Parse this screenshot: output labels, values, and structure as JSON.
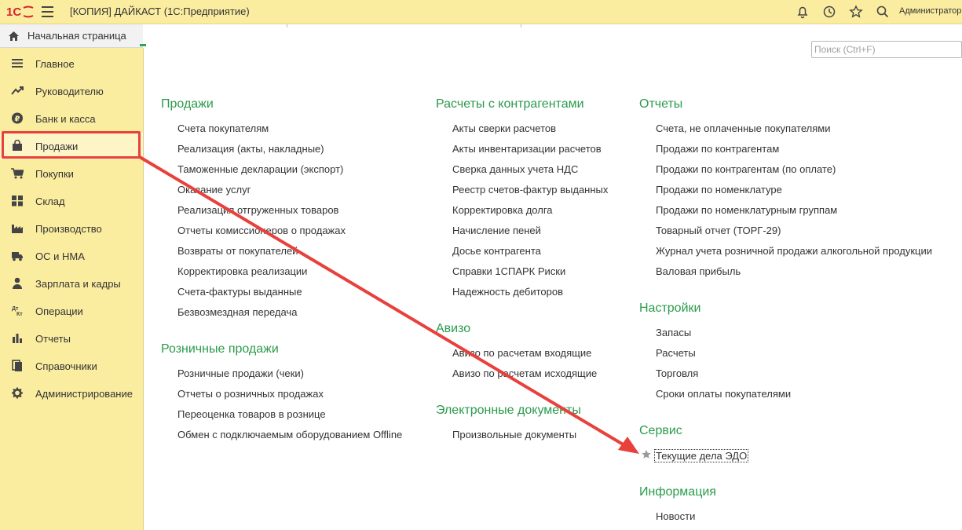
{
  "titlebar": {
    "title": "[КОПИЯ] ДАЙКАСТ  (1С:Предприятие)",
    "user": "Администратор"
  },
  "home": {
    "label": "Начальная страница"
  },
  "search": {
    "placeholder": "Поиск (Ctrl+F)"
  },
  "sidebar": {
    "items": [
      {
        "label": "Главное",
        "icon": "menu-lines-icon"
      },
      {
        "label": "Руководителю",
        "icon": "trend-icon"
      },
      {
        "label": "Банк и касса",
        "icon": "ruble-coin-icon"
      },
      {
        "label": "Продажи",
        "icon": "shopping-bag-icon",
        "active": true
      },
      {
        "label": "Покупки",
        "icon": "cart-icon"
      },
      {
        "label": "Склад",
        "icon": "grid-icon"
      },
      {
        "label": "Производство",
        "icon": "factory-icon"
      },
      {
        "label": "ОС и НМА",
        "icon": "truck-icon"
      },
      {
        "label": "Зарплата и кадры",
        "icon": "person-icon"
      },
      {
        "label": "Операции",
        "icon": "dt-kt-icon"
      },
      {
        "label": "Отчеты",
        "icon": "bar-chart-icon"
      },
      {
        "label": "Справочники",
        "icon": "books-icon"
      },
      {
        "label": "Администрирование",
        "icon": "gear-icon"
      }
    ]
  },
  "sections": {
    "sales": {
      "title": "Продажи",
      "items": [
        "Счета покупателям",
        "Реализация (акты, накладные)",
        "Таможенные декларации (экспорт)",
        "Оказание услуг",
        "Реализация отгруженных товаров",
        "Отчеты комиссионеров о продажах",
        "Возвраты от покупателей",
        "Корректировка реализации",
        "Счета-фактуры выданные",
        "Безвозмездная передача"
      ]
    },
    "retail": {
      "title": "Розничные продажи",
      "items": [
        "Розничные продажи (чеки)",
        "Отчеты о розничных продажах",
        "Переоценка товаров в рознице",
        "Обмен с подключаемым оборудованием Offline"
      ]
    },
    "counterparties": {
      "title": "Расчеты с контрагентами",
      "items": [
        "Акты сверки расчетов",
        "Акты инвентаризации расчетов",
        "Сверка данных учета НДС",
        "Реестр счетов-фактур выданных",
        "Корректировка долга",
        "Начисление пеней",
        "Досье контрагента",
        "Справки 1СПАРК Риски",
        "Надежность дебиторов"
      ]
    },
    "aviso": {
      "title": "Авизо",
      "items": [
        "Авизо по расчетам входящие",
        "Авизо по расчетам исходящие"
      ]
    },
    "edocs": {
      "title": "Электронные документы",
      "items": [
        "Произвольные документы"
      ]
    },
    "reports": {
      "title": "Отчеты",
      "items": [
        "Счета, не оплаченные покупателями",
        "Продажи по контрагентам",
        "Продажи по контрагентам (по оплате)",
        "Продажи по номенклатуре",
        "Продажи по номенклатурным группам",
        "Товарный отчет (ТОРГ-29)",
        "Журнал учета розничной продажи алкогольной продукции",
        "Валовая прибыль"
      ]
    },
    "settings": {
      "title": "Настройки",
      "items": [
        "Запасы",
        "Расчеты",
        "Торговля",
        "Сроки оплаты покупателями"
      ]
    },
    "service": {
      "title": "Сервис",
      "items": [
        "Текущие дела ЭДО"
      ]
    },
    "info": {
      "title": "Информация",
      "items": [
        "Новости"
      ]
    }
  },
  "colors": {
    "accent_green": "#2a9b4c",
    "sidebar_bg": "#fbeda0",
    "highlight_red": "#e8413c"
  }
}
